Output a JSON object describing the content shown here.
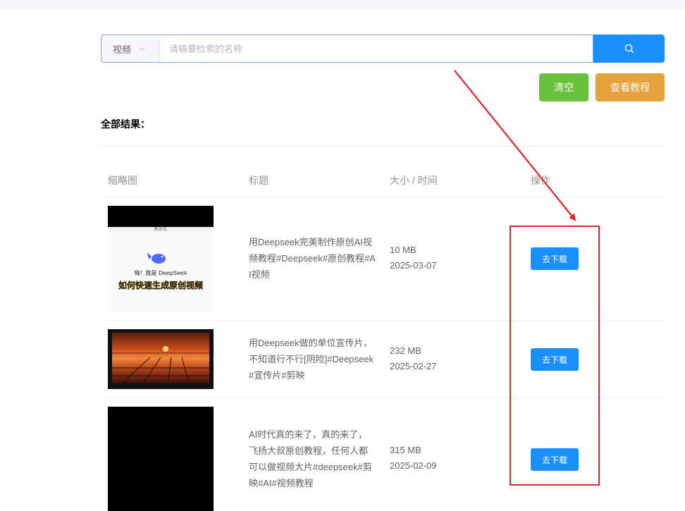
{
  "search": {
    "type_value": "视频",
    "placeholder": "请输要检索的名称"
  },
  "buttons": {
    "clear": "清空",
    "tutorial": "查看教程",
    "search_icon": "search-icon"
  },
  "results_label": "全部结果：",
  "table": {
    "headers": [
      "缩略图",
      "标题",
      "大小 / 时间",
      "操作"
    ],
    "rows": [
      {
        "title": "用Deepseek完美制作原创AI视频教程#Deepseek#原创教程#AI视频",
        "size": "10 MB",
        "date": "2025-03-07",
        "action": "去下载",
        "thumb_text_1": "嗨！我是 DeepSeek",
        "thumb_text_2": "如何快速生成原创视频",
        "thumb_text_3": "新对话"
      },
      {
        "title": "用Deepseek做的单位宣传片，不知道行不行[阴险]#Deepseek#宣传片#剪映",
        "size": "232 MB",
        "date": "2025-02-27",
        "action": "去下载"
      },
      {
        "title": "AI时代真的来了，真的来了，飞扬大叔原创教程，任何人都可以做视频大片#deepseek#剪映#AI#视频教程",
        "size": "315 MB",
        "date": "2025-02-09",
        "action": "去下载"
      }
    ]
  },
  "colors": {
    "primary": "#1890ff",
    "success": "#67c23a",
    "warning": "#e6a23c",
    "annotation": "#e0252b"
  }
}
